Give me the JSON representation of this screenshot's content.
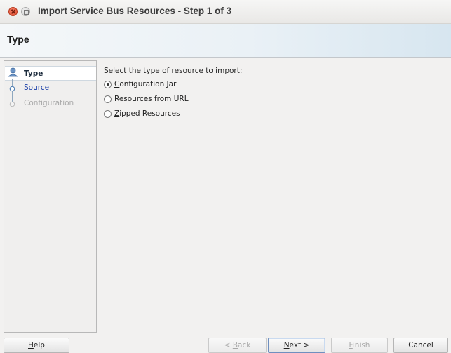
{
  "window": {
    "title": "Import Service Bus Resources - Step 1 of 3"
  },
  "header": {
    "title": "Type"
  },
  "nav": {
    "steps": [
      {
        "label": "Type",
        "state": "current"
      },
      {
        "label": "Source",
        "state": "link"
      },
      {
        "label": "Configuration",
        "state": "disabled"
      }
    ]
  },
  "content": {
    "prompt": "Select the type of resource to import:",
    "options": [
      {
        "mnemonic": "C",
        "rest": "onfiguration Jar",
        "selected": true
      },
      {
        "mnemonic": "R",
        "rest": "esources from URL",
        "selected": false
      },
      {
        "mnemonic": "Z",
        "rest": "ipped Resources",
        "selected": false
      }
    ]
  },
  "buttons": {
    "help": {
      "mnemonic": "H",
      "rest": "elp"
    },
    "back": {
      "prefix": "< ",
      "mnemonic": "B",
      "rest": "ack",
      "enabled": false
    },
    "next": {
      "mnemonic": "N",
      "rest": "ext >",
      "enabled": true
    },
    "finish": {
      "mnemonic": "F",
      "rest": "inish",
      "enabled": false
    },
    "cancel": {
      "label": "Cancel",
      "enabled": true
    }
  },
  "colors": {
    "link": "#1a3fa8",
    "disabled_text": "#a9a9a9",
    "close_button": "#dd4a2a"
  },
  "icons": {
    "close": "close-icon",
    "maximize": "maximize-icon",
    "step_current": "step-current-icon",
    "step_next": "step-node-icon",
    "step_pending": "step-pending-icon"
  }
}
